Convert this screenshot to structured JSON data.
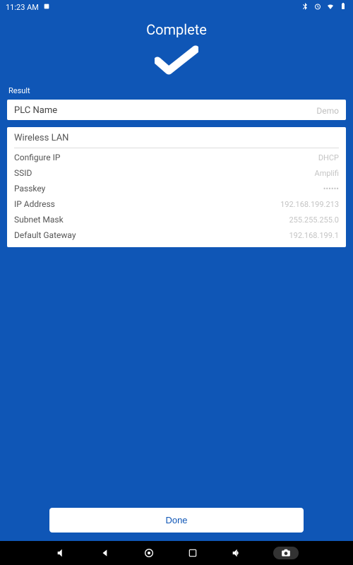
{
  "statusbar": {
    "time": "11:23 AM"
  },
  "header": {
    "title": "Complete"
  },
  "section_label": "Result",
  "plc_card": {
    "label": "PLC Name",
    "value": "Demo"
  },
  "wlan_card": {
    "title": "Wireless LAN",
    "rows": [
      {
        "label": "Configure IP",
        "value": "DHCP"
      },
      {
        "label": "SSID",
        "value": "Amplifi"
      },
      {
        "label": "Passkey",
        "value": "••••••"
      },
      {
        "label": "IP Address",
        "value": "192.168.199.213"
      },
      {
        "label": "Subnet Mask",
        "value": "255.255.255.0"
      },
      {
        "label": "Default Gateway",
        "value": "192.168.199.1"
      }
    ]
  },
  "done_button": {
    "label": "Done"
  }
}
